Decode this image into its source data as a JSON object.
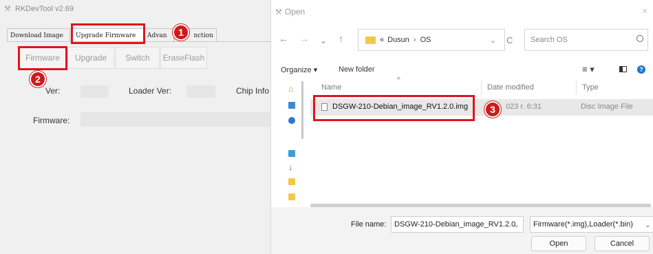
{
  "rk": {
    "title": "RKDevTool v2.69",
    "tabs": [
      "Download Image",
      "Upgrade Firmware",
      "Advan",
      "nction"
    ],
    "subtabs": [
      "Firmware",
      "Upgrade",
      "Switch",
      "EraseFlash"
    ],
    "fw_ver_label": "Ver:",
    "loader_ver_label": "Loader Ver:",
    "chip_info_label": "Chip Info",
    "firmware_label": "Firmware:"
  },
  "badges": [
    "1",
    "2",
    "3"
  ],
  "dialog": {
    "title": "Open",
    "close": "×",
    "nav": {
      "back": "←",
      "forward": "→",
      "dropdown": "⌄",
      "up": "↑",
      "refresh": "C",
      "addr_dropdown": "⌄"
    },
    "breadcrumb": {
      "prefix": "«",
      "parent": "Dusun",
      "sep": "›",
      "current": "OS"
    },
    "search_placeholder": "Search OS",
    "toolbar": {
      "organize": "Organize",
      "new_folder": "New folder"
    },
    "columns": {
      "name": "Name",
      "date": "Date modified",
      "type": "Type"
    },
    "file": {
      "name": "DSGW-210-Debian_image_RV1.2.0.img",
      "date": "023 r. 6:31",
      "type": "Disc Image File"
    },
    "file_name_label": "File name:",
    "file_name_value": "DSGW-210-Debian_image_RV1.2.0",
    "filter": "Firmware(*.img),Loader(*.bin)",
    "open_button": "Open",
    "cancel_button": "Cancel"
  },
  "colors": {
    "highlight": "#e0141e",
    "badge": "#cc1b1b",
    "folder": "#f2c84b",
    "accent": "#2f7fd7"
  }
}
